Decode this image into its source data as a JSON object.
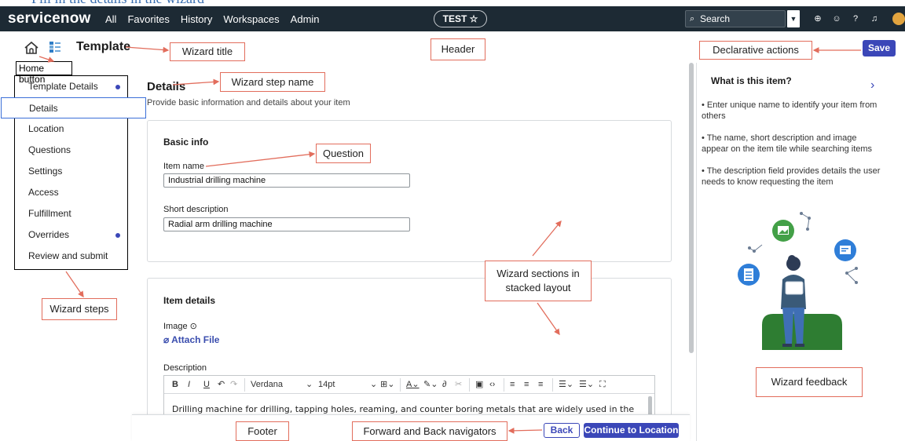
{
  "top_heading": "Fill in the details in the wizard",
  "header": {
    "logo": "servicenow",
    "nav": [
      "All",
      "Favorites",
      "History",
      "Workspaces",
      "Admin"
    ],
    "instance_label": "TEST ☆",
    "search_placeholder": "Search"
  },
  "titlebar": {
    "title": "Template",
    "save_label": "Save"
  },
  "steps": [
    {
      "label": "Template Details",
      "dot": true
    },
    {
      "label": "Details",
      "dot": false,
      "active": true
    },
    {
      "label": "Location",
      "dot": false
    },
    {
      "label": "Questions",
      "dot": false
    },
    {
      "label": "Settings",
      "dot": false
    },
    {
      "label": "Access",
      "dot": false
    },
    {
      "label": "Fulfillment",
      "dot": false
    },
    {
      "label": "Overrides",
      "dot": true
    },
    {
      "label": "Review and submit",
      "dot": false
    }
  ],
  "main": {
    "title": "Details",
    "subtitle": "Provide basic information and details about your item",
    "basic_info": {
      "heading": "Basic info",
      "item_name_label": "Item name",
      "item_name_value": "Industrial drilling machine",
      "short_desc_label": "Short description",
      "short_desc_value": "Radial arm drilling machine"
    },
    "item_details": {
      "heading": "Item details",
      "image_label": "Image ⊙",
      "attach_label": "⌀ Attach File",
      "description_label": "Description",
      "font_family": "Verdana",
      "font_size": "14pt",
      "description_text": "Drilling machine for drilling, tapping holes, reaming, and counter boring metals that are widely used in the"
    }
  },
  "footer": {
    "back_label": "Back",
    "continue_label": "Continue to Location"
  },
  "feedback": {
    "title": "What is this item?",
    "items": [
      "•  Enter unique name to identify your item from others",
      "•  The name, short description and image appear on the item tile while searching items",
      "•  The description field provides details the user needs to know requesting the item"
    ]
  },
  "annotations": {
    "home_button": "Home button",
    "wizard_title": "Wizard title",
    "header": "Header",
    "declarative_actions": "Declarative actions",
    "wizard_step_name": "Wizard step name",
    "question": "Question",
    "wizard_sections": "Wizard sections in stacked layout",
    "wizard_steps": "Wizard steps",
    "wizard_feedback": "Wizard feedback",
    "footer": "Footer",
    "navigators": "Forward and Back navigators"
  },
  "colors": {
    "header_bg": "#1d2a34",
    "brand_button": "#3b47b8",
    "annotation_border": "#e26d5c"
  }
}
